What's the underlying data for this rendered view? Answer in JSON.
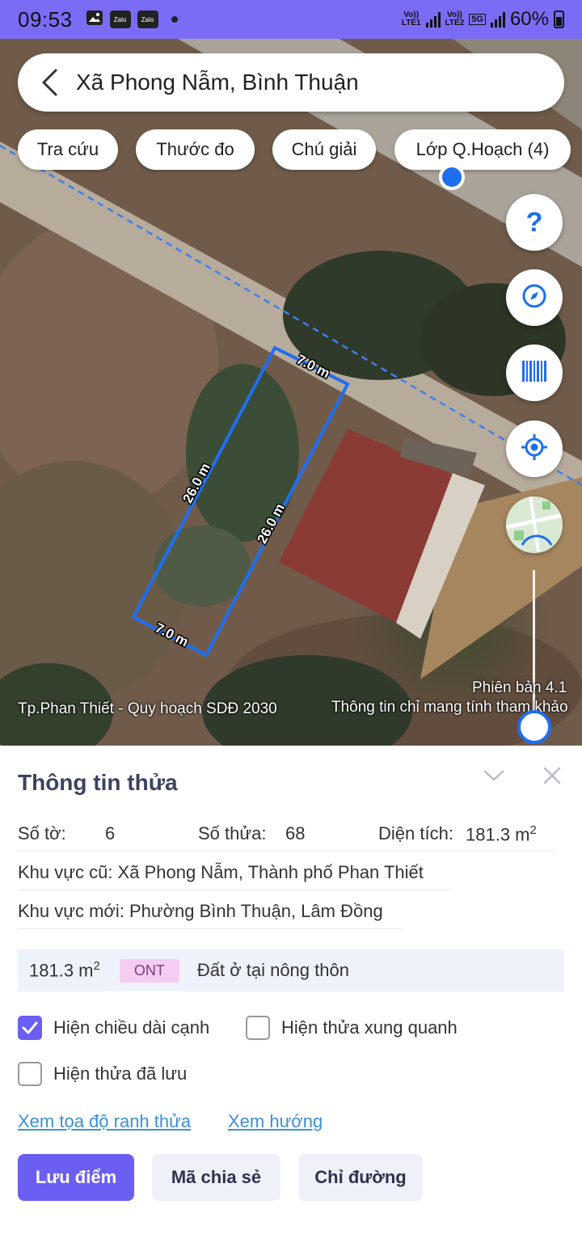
{
  "status_bar": {
    "time": "09:53",
    "apps": [
      "Zalo",
      "Zalo"
    ],
    "net1": "LTE1",
    "net2": "LTE2",
    "net_5g": "5G",
    "volte": "Vo))",
    "battery": "60%"
  },
  "search": {
    "title": "Xã Phong Nẫm, Bình Thuận"
  },
  "chips": [
    "Tra cứu",
    "Thước đo",
    "Chú giải",
    "Lớp Q.Hoạch (4)"
  ],
  "map": {
    "edge_labels": [
      "7.0 m",
      "26.0 m",
      "26.0 m",
      "7.0 m"
    ],
    "left_caption": "Tp.Phan Thiết - Quy hoạch SDĐ 2030",
    "version": "Phiên bản 4.1",
    "disclaimer": "Thông tin chỉ mang tính tham khảo",
    "help_glyph": "?",
    "parcel_color": "#1e6ff0"
  },
  "sheet": {
    "title": "Thông tin thửa",
    "so_to_label": "Số tờ:",
    "so_to_value": "6",
    "so_thua_label": "Số thửa:",
    "so_thua_value": "68",
    "dien_tich_label": "Diện tích:",
    "dien_tich_value": "181.3 m",
    "area_sup": "2",
    "khu_vuc_cu": "Khu vực cũ: Xã Phong Nẫm, Thành phố Phan Thiết",
    "khu_vuc_moi": "Khu vực mới: Phường Bình Thuận, Lâm Đồng",
    "landuse": {
      "area": "181.3 m",
      "area_sup": "2",
      "code": "ONT",
      "desc": "Đất ở tại nông thôn"
    },
    "checkboxes": [
      {
        "label": "Hiện chiều dài cạnh",
        "checked": true
      },
      {
        "label": "Hiện thửa xung quanh",
        "checked": false
      },
      {
        "label": "Hiện thửa đã lưu",
        "checked": false
      }
    ],
    "links": [
      "Xem tọa độ ranh thửa",
      "Xem hướng"
    ],
    "buttons": [
      "Lưu điểm",
      "Mã chia sẻ",
      "Chỉ đường"
    ]
  },
  "colors": {
    "accent": "#6b5ef2",
    "status_bar": "#7b6cf6",
    "link": "#3b8fd8",
    "ont_badge": "#f5cdf2"
  }
}
